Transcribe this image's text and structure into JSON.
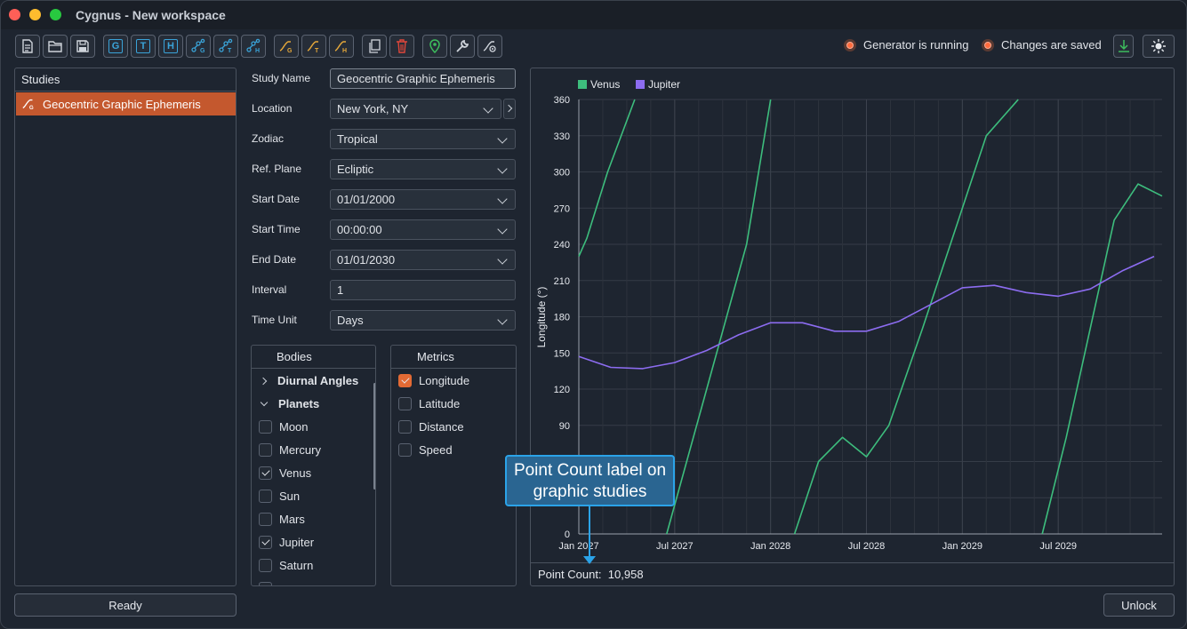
{
  "window": {
    "title": "Cygnus - New workspace"
  },
  "toolbar": {
    "buttons": [
      "new-file",
      "open-folder",
      "save",
      "G",
      "T",
      "H",
      "graph-G",
      "graph-T",
      "graph-H",
      "chart-G",
      "chart-T",
      "chart-H",
      "copy",
      "delete",
      "location",
      "wrench",
      "settings"
    ]
  },
  "status": {
    "generator": "Generator is running",
    "saved": "Changes are saved"
  },
  "studies": {
    "title": "Studies",
    "items": [
      "Geocentric Graphic Ephemeris"
    ]
  },
  "form": {
    "study_name_label": "Study Name",
    "study_name": "Geocentric Graphic Ephemeris",
    "location_label": "Location",
    "location": "New York, NY",
    "zodiac_label": "Zodiac",
    "zodiac": "Tropical",
    "refplane_label": "Ref. Plane",
    "refplane": "Ecliptic",
    "start_date_label": "Start Date",
    "start_date": "01/01/2000",
    "start_time_label": "Start Time",
    "start_time": "00:00:00",
    "end_date_label": "End Date",
    "end_date": "01/01/2030",
    "interval_label": "Interval",
    "interval": "1",
    "time_unit_label": "Time Unit",
    "time_unit": "Days"
  },
  "bodies": {
    "title": "Bodies",
    "groups": [
      "Diurnal Angles",
      "Planets"
    ],
    "items": [
      {
        "label": "Moon",
        "checked": false
      },
      {
        "label": "Mercury",
        "checked": false
      },
      {
        "label": "Venus",
        "checked": true
      },
      {
        "label": "Sun",
        "checked": false
      },
      {
        "label": "Mars",
        "checked": false
      },
      {
        "label": "Jupiter",
        "checked": true
      },
      {
        "label": "Saturn",
        "checked": false
      }
    ]
  },
  "metrics": {
    "title": "Metrics",
    "items": [
      {
        "label": "Longitude",
        "checked": true
      },
      {
        "label": "Latitude",
        "checked": false
      },
      {
        "label": "Distance",
        "checked": false
      },
      {
        "label": "Speed",
        "checked": false
      }
    ]
  },
  "chart_data": {
    "type": "line",
    "ylabel": "Longitude (°)",
    "xlabel": "",
    "ylim": [
      0,
      360
    ],
    "yticks": [
      0,
      30,
      60,
      90,
      120,
      150,
      180,
      210,
      240,
      270,
      300,
      330,
      360
    ],
    "xticks": [
      "Jan 2027",
      "Jul 2027",
      "Jan 2028",
      "Jul 2028",
      "Jan 2029",
      "Jul 2029"
    ],
    "legend": "top-left",
    "grid": true,
    "series": [
      {
        "name": "Venus",
        "color": "#3dbd7d",
        "x": [
          0,
          0.5,
          1.8,
          3.5,
          5.5,
          8.0,
          10.5,
          12.0,
          13.5,
          15.0,
          16.5,
          18.0,
          19.4,
          21.5,
          23.5,
          25.5,
          27.5,
          29.0,
          30.5,
          32.0,
          33.5,
          35.0,
          36.5
        ],
        "y": [
          230,
          245,
          300,
          360,
          0,
          120,
          240,
          360,
          0,
          60,
          80,
          64,
          90,
          170,
          250,
          330,
          360,
          0,
          80,
          170,
          260,
          290,
          280
        ]
      },
      {
        "name": "Jupiter",
        "color": "#8c6cf0",
        "x": [
          0,
          2,
          4,
          6,
          8,
          10,
          12,
          14,
          16,
          18,
          20,
          22,
          24,
          26,
          28,
          30,
          32,
          34,
          36
        ],
        "y": [
          147,
          138,
          137,
          142,
          152,
          165,
          175,
          175,
          168,
          168,
          176,
          190,
          204,
          206,
          200,
          197,
          203,
          218,
          230
        ]
      }
    ]
  },
  "point_count": {
    "label": "Point Count:",
    "value": "10,958"
  },
  "callout": {
    "text": "Point Count label on graphic studies"
  },
  "footer": {
    "ready": "Ready",
    "unlock": "Unlock"
  }
}
